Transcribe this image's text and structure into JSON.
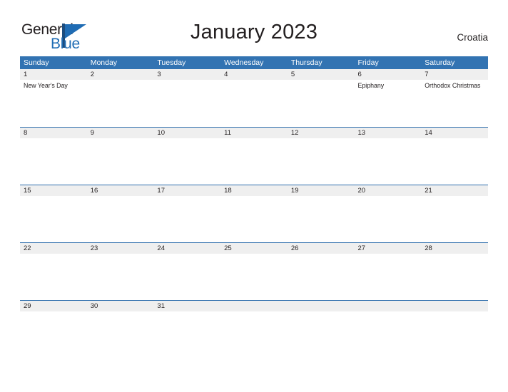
{
  "brand": {
    "word_one": "General",
    "word_two": "Blue",
    "accent_color": "#1f6cb4"
  },
  "header": {
    "title": "January 2023",
    "country": "Croatia"
  },
  "theme": {
    "header_blue": "#3273b2",
    "row_divider_blue": "#2f6fad",
    "date_strip_gray": "#efefef",
    "text_color": "#231f20"
  },
  "calendar": {
    "weekdays": [
      "Sunday",
      "Monday",
      "Tuesday",
      "Wednesday",
      "Thursday",
      "Friday",
      "Saturday"
    ],
    "weeks": [
      {
        "days": [
          {
            "date": "1",
            "events": [
              "New Year's Day"
            ]
          },
          {
            "date": "2",
            "events": []
          },
          {
            "date": "3",
            "events": []
          },
          {
            "date": "4",
            "events": []
          },
          {
            "date": "5",
            "events": []
          },
          {
            "date": "6",
            "events": [
              "Epiphany"
            ]
          },
          {
            "date": "7",
            "events": [
              "Orthodox Christmas"
            ]
          }
        ]
      },
      {
        "days": [
          {
            "date": "8",
            "events": []
          },
          {
            "date": "9",
            "events": []
          },
          {
            "date": "10",
            "events": []
          },
          {
            "date": "11",
            "events": []
          },
          {
            "date": "12",
            "events": []
          },
          {
            "date": "13",
            "events": []
          },
          {
            "date": "14",
            "events": []
          }
        ]
      },
      {
        "days": [
          {
            "date": "15",
            "events": []
          },
          {
            "date": "16",
            "events": []
          },
          {
            "date": "17",
            "events": []
          },
          {
            "date": "18",
            "events": []
          },
          {
            "date": "19",
            "events": []
          },
          {
            "date": "20",
            "events": []
          },
          {
            "date": "21",
            "events": []
          }
        ]
      },
      {
        "days": [
          {
            "date": "22",
            "events": []
          },
          {
            "date": "23",
            "events": []
          },
          {
            "date": "24",
            "events": []
          },
          {
            "date": "25",
            "events": []
          },
          {
            "date": "26",
            "events": []
          },
          {
            "date": "27",
            "events": []
          },
          {
            "date": "28",
            "events": []
          }
        ]
      },
      {
        "days": [
          {
            "date": "29",
            "events": []
          },
          {
            "date": "30",
            "events": []
          },
          {
            "date": "31",
            "events": []
          },
          {
            "date": "",
            "events": []
          },
          {
            "date": "",
            "events": []
          },
          {
            "date": "",
            "events": []
          },
          {
            "date": "",
            "events": []
          }
        ]
      }
    ]
  }
}
